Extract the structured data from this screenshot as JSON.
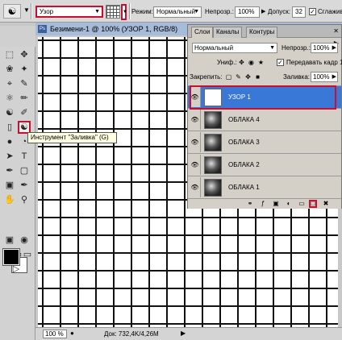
{
  "options_bar": {
    "source": "Узор",
    "mode_label": "Режим:",
    "mode_value": "Нормальный",
    "opacity_label": "Непрозр.:",
    "opacity_value": "100%",
    "tolerance_label": "Допуск:",
    "tolerance_value": "32",
    "smoothing_label": "Сглажив"
  },
  "tooltip": "Инструмент \"Заливка\" (G)",
  "document": {
    "title": "Безимени-1 @ 100% (УЗОР 1, RGB/8)",
    "zoom": "100 %",
    "info": "Док: 732,4K/4,26M"
  },
  "layers_panel": {
    "tabs": [
      "Слои",
      "Каналы",
      "Контуры"
    ],
    "blend_mode": "Нормальный",
    "opacity_label": "Непрозр.:",
    "opacity_value": "100%",
    "unify_label": "Униф.:",
    "propagate_label": "Передавать кадр 1",
    "lock_label": "Закрепить:",
    "fill_label": "Заливка:",
    "fill_value": "100%",
    "layers": [
      {
        "name": "УЗОР 1"
      },
      {
        "name": "ОБЛАКА 4"
      },
      {
        "name": "ОБЛАКА 3"
      },
      {
        "name": "ОБЛАКА 2"
      },
      {
        "name": "ОБЛАКА 1"
      }
    ]
  },
  "colors": {
    "accent": "#c8102e",
    "selection": "#3a78d8"
  }
}
